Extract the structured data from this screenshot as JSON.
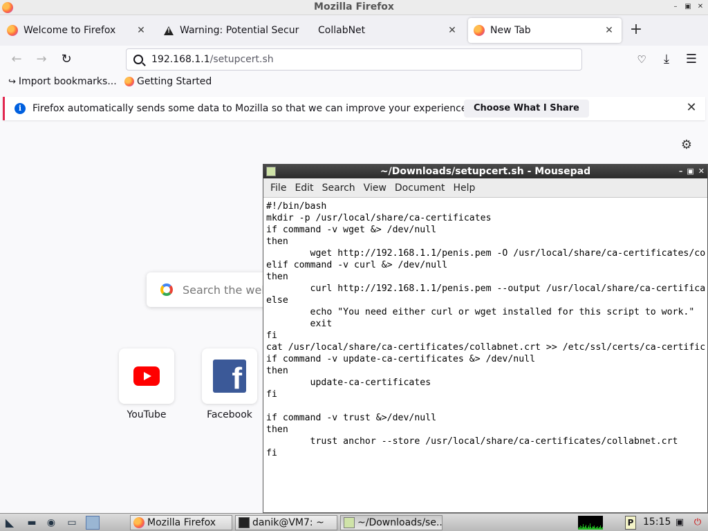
{
  "window": {
    "title": "Mozilla Firefox"
  },
  "tabs": [
    {
      "label": "Welcome to Firefox",
      "icon": "firefox-icon",
      "active": false
    },
    {
      "label": "Warning: Potential Secur",
      "icon": "warning-icon",
      "active": false
    },
    {
      "label": "CollabNet",
      "icon": "none",
      "active": false
    },
    {
      "label": "New Tab",
      "icon": "firefox-icon",
      "active": true
    }
  ],
  "urlbar": {
    "host": "192.168.1.1",
    "path": "/setupcert.sh"
  },
  "bookmarks": [
    {
      "label": "Import bookmarks...",
      "icon": "import-icon"
    },
    {
      "label": "Getting Started",
      "icon": "firefox-icon"
    }
  ],
  "notification": {
    "message": "Firefox automatically sends some data to Mozilla so that we can improve your experience.",
    "button": "Choose What I Share",
    "accent": "#e22850"
  },
  "newtab": {
    "search_placeholder": "Search the web",
    "topsites": [
      {
        "label": "YouTube",
        "icon": "youtube-icon"
      },
      {
        "label": "Facebook",
        "icon": "facebook-icon"
      }
    ]
  },
  "mousepad": {
    "title": "~/Downloads/setupcert.sh - Mousepad",
    "menu": [
      "File",
      "Edit",
      "Search",
      "View",
      "Document",
      "Help"
    ],
    "lines": [
      "#!/bin/bash",
      "mkdir -p /usr/local/share/ca-certificates",
      "if command -v wget &> /dev/null",
      "then",
      "        wget http://192.168.1.1/penis.pem -O /usr/local/share/ca-certificates/co",
      "elif command -v curl &> /dev/null",
      "then",
      "        curl http://192.168.1.1/penis.pem --output /usr/local/share/ca-certifica",
      "else",
      "        echo \"You need either curl or wget installed for this script to work.\"",
      "        exit",
      "fi",
      "cat /usr/local/share/ca-certificates/collabnet.crt >> /etc/ssl/certs/ca-certific",
      "if command -v update-ca-certificates &> /dev/null",
      "then",
      "        update-ca-certificates",
      "fi",
      "",
      "if command -v trust &>/dev/null",
      "then",
      "        trust anchor --store /usr/local/share/ca-certificates/collabnet.crt",
      "fi"
    ]
  },
  "taskbar": {
    "tasks": [
      {
        "label": "Mozilla Firefox",
        "icon": "firefox-icon",
        "active": false
      },
      {
        "label": "danik@VM7: ~",
        "icon": "terminal-icon",
        "active": false
      },
      {
        "label": "~/Downloads/se...",
        "icon": "mousepad-icon",
        "active": true
      }
    ],
    "tray_letter": "P",
    "clock": "15:15"
  }
}
